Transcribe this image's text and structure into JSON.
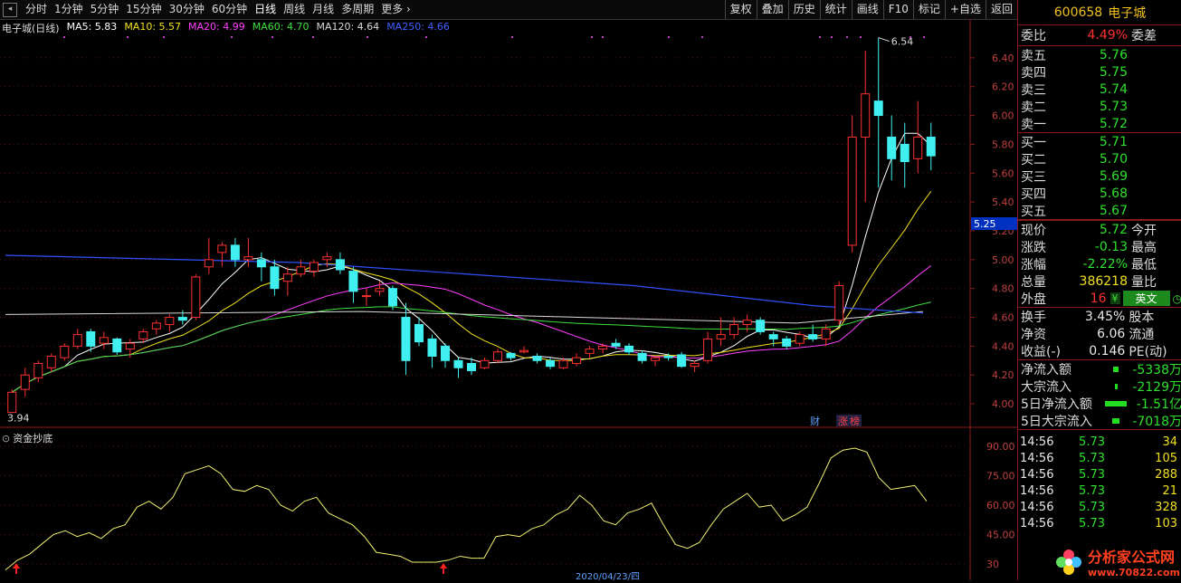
{
  "toolbar": {
    "periods": [
      "分时",
      "1分钟",
      "5分钟",
      "15分钟",
      "30分钟",
      "60分钟",
      "日线",
      "周线",
      "月线",
      "多周期",
      "更多 ›"
    ],
    "active_period": "日线",
    "right_buttons": [
      "复权",
      "叠加",
      "历史",
      "统计",
      "画线",
      "F10",
      "标记",
      "+自选",
      "返回"
    ]
  },
  "main_chart": {
    "title": "电子城(日线)",
    "ma_labels": [
      {
        "label": "MA5: 5.83",
        "color": "#ffffff"
      },
      {
        "label": "MA10: 5.57",
        "color": "#f0e020"
      },
      {
        "label": "MA20: 4.99",
        "color": "#ff40ff"
      },
      {
        "label": "MA60: 4.70",
        "color": "#40e040"
      },
      {
        "label": "MA120: 4.64",
        "color": "#d8d8d8"
      },
      {
        "label": "MA250: 4.66",
        "color": "#4060ff"
      }
    ],
    "price_ticks": [
      "6.40",
      "6.20",
      "6.00",
      "5.80",
      "5.60",
      "5.40",
      "5.20",
      "5.00",
      "4.80",
      "4.60",
      "4.40",
      "4.20",
      "4.00"
    ],
    "price_box": "5.25",
    "high_label": "6.54",
    "low_label": "3.94",
    "markers": [
      "财",
      "涨",
      "榜"
    ]
  },
  "sub_chart": {
    "title": "资金抄底",
    "ticks": [
      "90.00",
      "75.00",
      "60.00",
      "45.00",
      "30"
    ],
    "bottom_labels": [
      "2020/04/23/四"
    ]
  },
  "chart_data": [
    {
      "type": "candlestick",
      "title": "",
      "ylim": [
        3.9,
        6.6
      ],
      "candles_ohlc": [
        [
          3.94,
          4.1,
          3.94,
          4.08
        ],
        [
          4.1,
          4.25,
          4.05,
          4.2
        ],
        [
          4.18,
          4.3,
          4.15,
          4.28
        ],
        [
          4.25,
          4.35,
          4.22,
          4.33
        ],
        [
          4.32,
          4.42,
          4.3,
          4.4
        ],
        [
          4.4,
          4.52,
          4.38,
          4.48
        ],
        [
          4.5,
          4.52,
          4.36,
          4.4
        ],
        [
          4.42,
          4.5,
          4.38,
          4.46
        ],
        [
          4.45,
          4.46,
          4.34,
          4.36
        ],
        [
          4.38,
          4.45,
          4.32,
          4.42
        ],
        [
          4.45,
          4.52,
          4.42,
          4.5
        ],
        [
          4.52,
          4.58,
          4.48,
          4.56
        ],
        [
          4.55,
          4.62,
          4.5,
          4.6
        ],
        [
          4.6,
          4.65,
          4.55,
          4.58
        ],
        [
          4.6,
          4.9,
          4.58,
          4.88
        ],
        [
          4.95,
          5.15,
          4.9,
          5.0
        ],
        [
          5.05,
          5.12,
          4.95,
          5.1
        ],
        [
          5.1,
          5.15,
          4.95,
          5.0
        ],
        [
          5.0,
          5.15,
          4.95,
          5.02
        ],
        [
          5.0,
          5.05,
          4.85,
          4.95
        ],
        [
          4.95,
          5.0,
          4.75,
          4.8
        ],
        [
          4.85,
          4.95,
          4.75,
          4.9
        ],
        [
          4.9,
          5.0,
          4.88,
          4.95
        ],
        [
          4.92,
          5.0,
          4.88,
          4.98
        ],
        [
          5.0,
          5.05,
          4.95,
          5.02
        ],
        [
          5.0,
          5.05,
          4.9,
          4.93
        ],
        [
          4.92,
          4.95,
          4.7,
          4.78
        ],
        [
          4.75,
          4.8,
          4.68,
          4.75
        ],
        [
          4.78,
          4.85,
          4.75,
          4.8
        ],
        [
          4.8,
          4.82,
          4.65,
          4.68
        ],
        [
          4.6,
          4.7,
          4.2,
          4.3
        ],
        [
          4.55,
          4.6,
          4.4,
          4.43
        ],
        [
          4.45,
          4.48,
          4.25,
          4.33
        ],
        [
          4.4,
          4.42,
          4.25,
          4.3
        ],
        [
          4.3,
          4.32,
          4.18,
          4.25
        ],
        [
          4.28,
          4.32,
          4.2,
          4.23
        ],
        [
          4.25,
          4.32,
          4.24,
          4.3
        ],
        [
          4.3,
          4.38,
          4.28,
          4.36
        ],
        [
          4.35,
          4.36,
          4.3,
          4.32
        ],
        [
          4.36,
          4.4,
          4.35,
          4.37
        ],
        [
          4.33,
          4.35,
          4.28,
          4.3
        ],
        [
          4.3,
          4.32,
          4.24,
          4.26
        ],
        [
          4.25,
          4.32,
          4.24,
          4.3
        ],
        [
          4.28,
          4.35,
          4.26,
          4.32
        ],
        [
          4.35,
          4.4,
          4.32,
          4.38
        ],
        [
          4.38,
          4.42,
          4.35,
          4.4
        ],
        [
          4.42,
          4.45,
          4.38,
          4.4
        ],
        [
          4.4,
          4.42,
          4.34,
          4.36
        ],
        [
          4.35,
          4.37,
          4.28,
          4.3
        ],
        [
          4.3,
          4.33,
          4.26,
          4.32
        ],
        [
          4.33,
          4.35,
          4.3,
          4.32
        ],
        [
          4.34,
          4.36,
          4.25,
          4.26
        ],
        [
          4.26,
          4.3,
          4.22,
          4.28
        ],
        [
          4.3,
          4.5,
          4.28,
          4.45
        ],
        [
          4.45,
          4.6,
          4.4,
          4.48
        ],
        [
          4.48,
          4.6,
          4.45,
          4.55
        ],
        [
          4.55,
          4.62,
          4.5,
          4.58
        ],
        [
          4.58,
          4.6,
          4.48,
          4.5
        ],
        [
          4.48,
          4.5,
          4.4,
          4.45
        ],
        [
          4.45,
          4.47,
          4.38,
          4.4
        ],
        [
          4.42,
          4.5,
          4.4,
          4.48
        ],
        [
          4.48,
          4.55,
          4.43,
          4.45
        ],
        [
          4.45,
          4.55,
          4.4,
          4.52
        ],
        [
          4.58,
          4.85,
          4.55,
          4.82
        ],
        [
          5.1,
          6.0,
          5.05,
          5.85
        ],
        [
          5.85,
          6.45,
          5.4,
          6.15
        ],
        [
          6.1,
          6.54,
          5.5,
          6.0
        ],
        [
          5.85,
          6.0,
          5.55,
          5.7
        ],
        [
          5.8,
          5.95,
          5.5,
          5.68
        ],
        [
          5.7,
          6.1,
          5.6,
          5.85
        ],
        [
          5.85,
          5.95,
          5.62,
          5.72
        ]
      ]
    },
    {
      "type": "line",
      "title": "",
      "series": [
        {
          "name": "资金抄底",
          "values": [
            27,
            32,
            35,
            40,
            45,
            47,
            44,
            46,
            43,
            48,
            50,
            59,
            62,
            58,
            64,
            76,
            78,
            80,
            76,
            68,
            67,
            70,
            68,
            60,
            57,
            62,
            64,
            56,
            53,
            50,
            44,
            36,
            35,
            34,
            31,
            31,
            31,
            32,
            34,
            33,
            33,
            44,
            45,
            44,
            48,
            50,
            55,
            58,
            65,
            60,
            52,
            50,
            56,
            58,
            61,
            50,
            40,
            38,
            41,
            50,
            58,
            62,
            66,
            59,
            60,
            52,
            55,
            59,
            71,
            84,
            88,
            89,
            87,
            74,
            68,
            69,
            70,
            62
          ]
        }
      ],
      "ylim": [
        25,
        95
      ]
    }
  ],
  "right_panel": {
    "code": "600658",
    "name": "电子城",
    "webi_label": "委比",
    "webi_value": "4.49%",
    "weicha_label": "委差",
    "sell": [
      {
        "label": "卖五",
        "price": "5.76"
      },
      {
        "label": "卖四",
        "price": "5.75"
      },
      {
        "label": "卖三",
        "price": "5.74"
      },
      {
        "label": "卖二",
        "price": "5.73"
      },
      {
        "label": "卖一",
        "price": "5.72"
      }
    ],
    "buy": [
      {
        "label": "买一",
        "price": "5.71"
      },
      {
        "label": "买二",
        "price": "5.70"
      },
      {
        "label": "买三",
        "price": "5.69"
      },
      {
        "label": "买四",
        "price": "5.68"
      },
      {
        "label": "买五",
        "price": "5.67"
      }
    ],
    "stats": [
      {
        "l1": "现价",
        "v1": "5.72",
        "c1": "green",
        "l2": "今开"
      },
      {
        "l1": "涨跌",
        "v1": "-0.13",
        "c1": "green",
        "l2": "最高"
      },
      {
        "l1": "涨幅",
        "v1": "-2.22%",
        "c1": "green",
        "l2": "最低"
      },
      {
        "l1": "总量",
        "v1": "386218",
        "c1": "yellow",
        "l2": "量比"
      },
      {
        "l1": "外盘",
        "v1": "16",
        "c1": "red",
        "l2": ""
      }
    ],
    "lang_button": "英文",
    "stats2": [
      {
        "l1": "换手",
        "v1": "3.45%",
        "l2": "股本"
      },
      {
        "l1": "净资",
        "v1": "6.06",
        "l2": "流通"
      },
      {
        "l1": "收益(-)",
        "v1": "0.146",
        "l2": "PE(动)"
      }
    ],
    "flows": [
      {
        "label": "净流入额",
        "value": "-5338万",
        "bar": 6
      },
      {
        "label": "大宗流入",
        "value": "-2129万",
        "bar": 3
      },
      {
        "label": "5日净流入额",
        "value": "-1.51亿",
        "bar": 24
      },
      {
        "label": "5日大宗流入",
        "value": "-7018万",
        "bar": 8
      }
    ],
    "ticks": [
      {
        "time": "14:56",
        "price": "5.73",
        "vol": "34"
      },
      {
        "time": "14:56",
        "price": "5.73",
        "vol": "105"
      },
      {
        "time": "14:56",
        "price": "5.73",
        "vol": "288"
      },
      {
        "time": "14:56",
        "price": "5.73",
        "vol": "21"
      },
      {
        "time": "14:56",
        "price": "5.73",
        "vol": "328"
      },
      {
        "time": "14:56",
        "price": "5.73",
        "vol": "103"
      }
    ],
    "watermark_text": "分析家公式网",
    "watermark_url": "www.70822.com"
  }
}
